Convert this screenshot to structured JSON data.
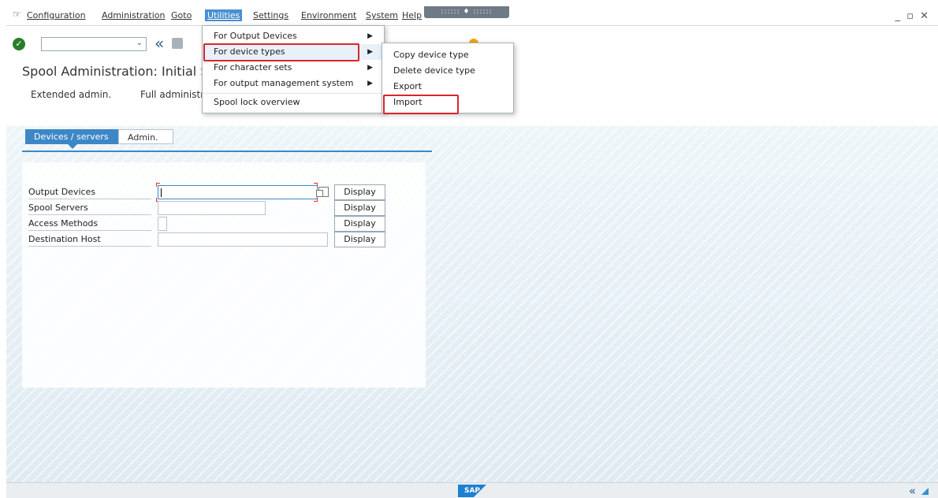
{
  "menubar": {
    "system_icon": "menu-icon",
    "items": [
      "Configuration",
      "Administration",
      "Goto",
      "Utilities",
      "Settings",
      "Environment",
      "System",
      "Help"
    ],
    "window_controls": "_ ▫ ✕"
  },
  "toolbar": {
    "back_glyph": "«"
  },
  "page": {
    "title": "Spool Administration: Initial Scre",
    "subtoolbar": [
      "Extended admin.",
      "Full administra"
    ]
  },
  "tabs": {
    "active": "Devices / servers",
    "inactive": "Admin."
  },
  "rows": [
    {
      "label": "Output Devices",
      "button": "Display",
      "value": ""
    },
    {
      "label": "Spool Servers",
      "value": ""
    },
    {
      "label": "Access Methods",
      "button": "Display",
      "value": ""
    },
    {
      "label": "Destination Host",
      "button": "Display",
      "value": ""
    }
  ],
  "extra_display_label": "Display",
  "utilities_menu": [
    {
      "label": "For Output Devices",
      "submenu": true
    },
    {
      "label": "For device types",
      "submenu": true
    },
    {
      "label": "For character sets",
      "submenu": true
    },
    {
      "label": "For output management system",
      "submenu": true
    },
    {
      "label": "Spool lock overview",
      "submenu": false
    }
  ],
  "device_types_submenu": [
    "Copy device type",
    "Delete device type",
    "Export",
    "Import"
  ],
  "footer": {
    "logo": "SAP",
    "collapse": "«"
  },
  "colors": {
    "accent": "#3e87c6",
    "highlight": "#d9262a",
    "menu_active": "#4a8fd0"
  }
}
